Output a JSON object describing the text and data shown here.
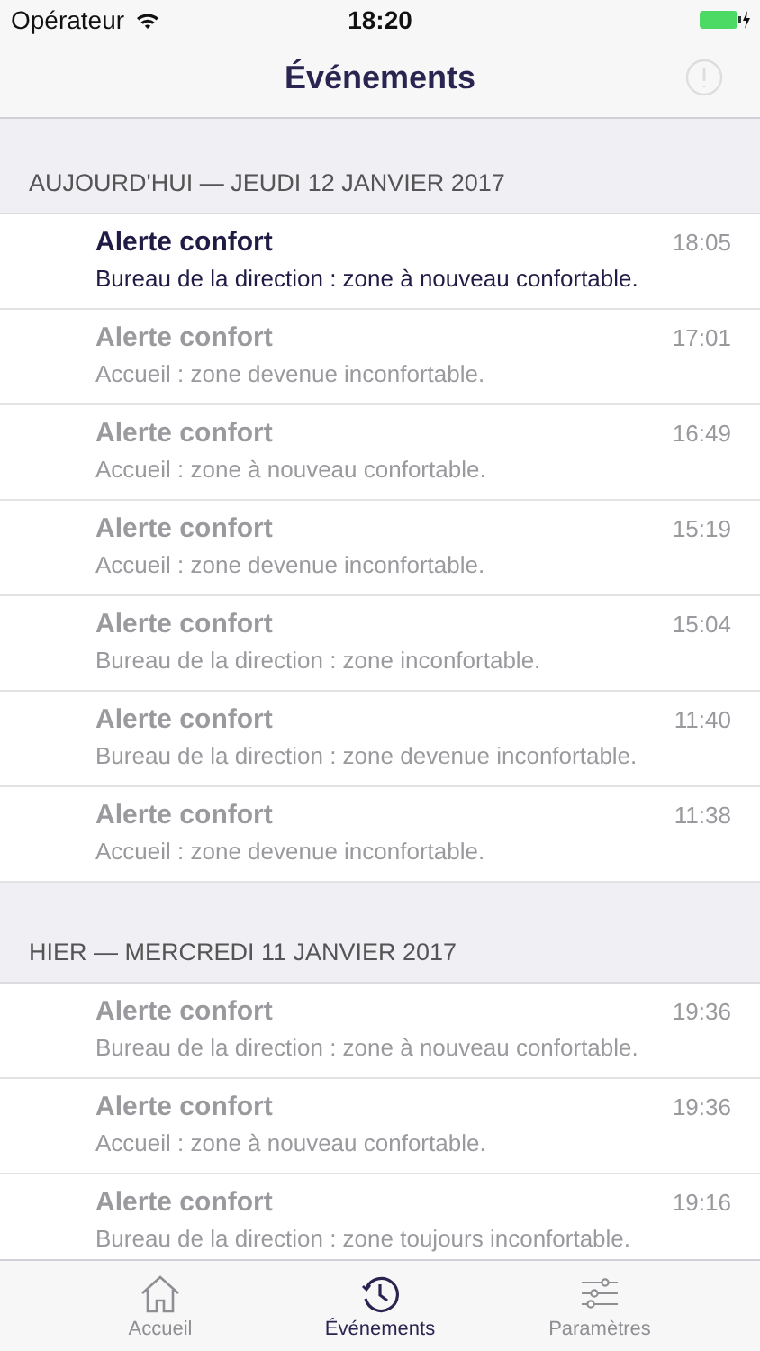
{
  "status_bar": {
    "carrier": "Opérateur",
    "time": "18:20"
  },
  "nav": {
    "title": "Événements"
  },
  "sections": [
    {
      "header": "AUJOURD'HUI — JEUDI 12 JANVIER 2017",
      "events": [
        {
          "title": "Alerte confort",
          "message": "Bureau de la direction : zone à nouveau confortable.",
          "time": "18:05",
          "unread": true
        },
        {
          "title": "Alerte confort",
          "message": "Accueil : zone devenue inconfortable.",
          "time": "17:01",
          "unread": false
        },
        {
          "title": "Alerte confort",
          "message": "Accueil : zone à nouveau confortable.",
          "time": "16:49",
          "unread": false
        },
        {
          "title": "Alerte confort",
          "message": "Accueil : zone devenue inconfortable.",
          "time": "15:19",
          "unread": false
        },
        {
          "title": "Alerte confort",
          "message": "Bureau de la direction : zone inconfortable.",
          "time": "15:04",
          "unread": false
        },
        {
          "title": "Alerte confort",
          "message": "Bureau de la direction : zone devenue inconfortable.",
          "time": "11:40",
          "unread": false
        },
        {
          "title": "Alerte confort",
          "message": "Accueil : zone devenue inconfortable.",
          "time": "11:38",
          "unread": false
        }
      ]
    },
    {
      "header": "HIER — MERCREDI 11 JANVIER 2017",
      "events": [
        {
          "title": "Alerte confort",
          "message": "Bureau de la direction : zone à nouveau confortable.",
          "time": "19:36",
          "unread": false
        },
        {
          "title": "Alerte confort",
          "message": "Accueil : zone à nouveau confortable.",
          "time": "19:36",
          "unread": false
        },
        {
          "title": "Alerte confort",
          "message": "Bureau de la direction : zone toujours inconfortable.",
          "time": "19:16",
          "unread": false
        }
      ]
    }
  ],
  "tabs": [
    {
      "label": "Accueil",
      "kind": "home",
      "selected": false
    },
    {
      "label": "Événements",
      "kind": "history",
      "selected": true
    },
    {
      "label": "Paramètres",
      "kind": "settings",
      "selected": false
    }
  ]
}
